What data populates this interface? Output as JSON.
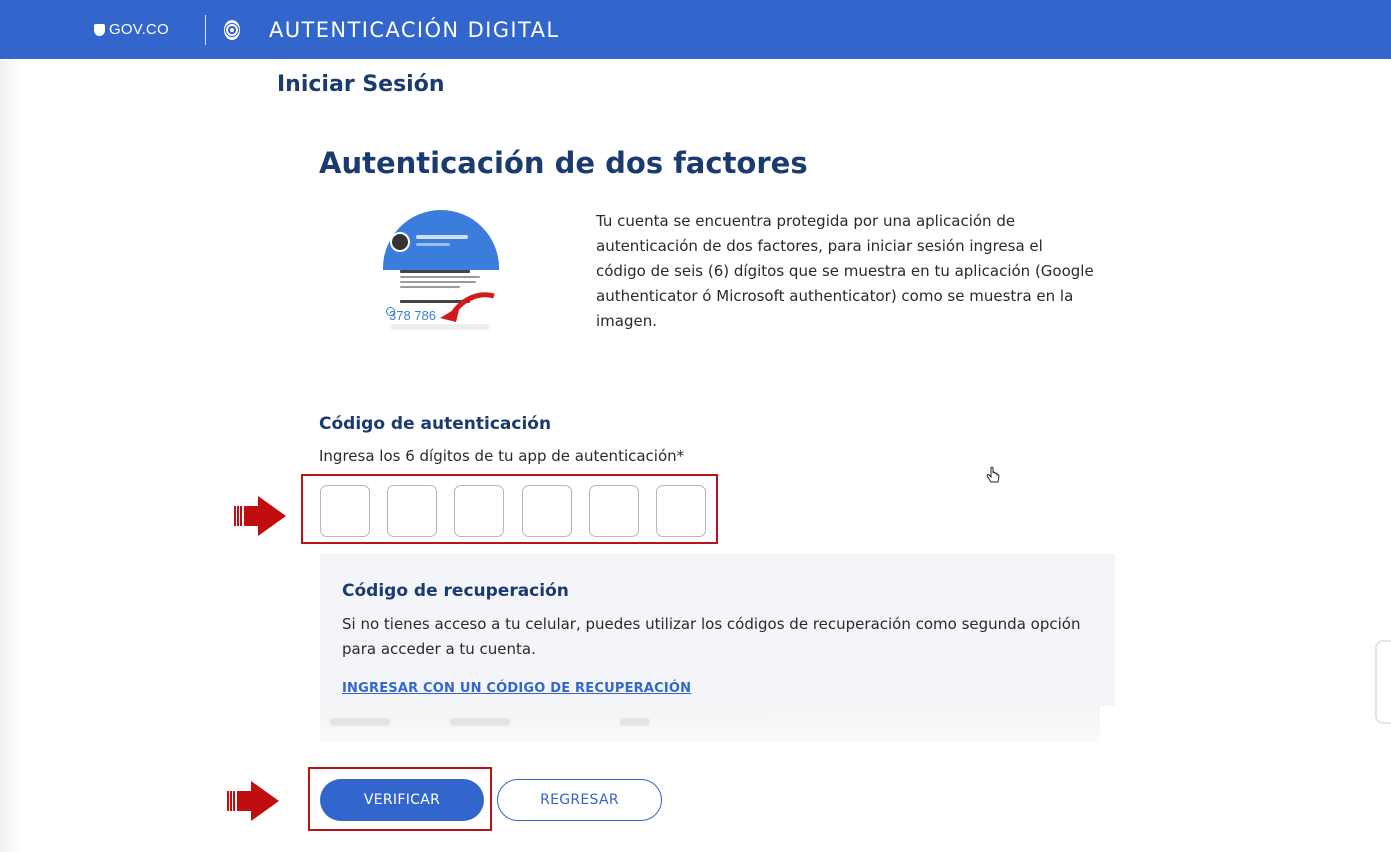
{
  "header": {
    "gov_logo": "GOV.CO",
    "title": "AUTENTICACIÓN DIGITAL"
  },
  "page": {
    "heading": "Iniciar Sesión",
    "title": "Autenticación de dos factores",
    "description": "Tu cuenta se encuentra protegida por una aplicación de autenticación de dos factores, para iniciar sesión ingresa el código de seis (6) dígitos que se muestra en tu aplicación (Google authenticator ó Microsoft authenticator) como se muestra en la imagen."
  },
  "illustration": {
    "code": "378 786"
  },
  "code_form": {
    "label": "Código de autenticación",
    "help": "Ingresa los 6 dígitos de tu app de autenticación*",
    "digits": [
      "",
      "",
      "",
      "",
      "",
      ""
    ]
  },
  "recovery": {
    "title": "Código de recuperación",
    "text": "Si no tienes acceso a tu celular, puedes utilizar los códigos de recuperación como segunda opción para acceder a tu cuenta.",
    "link": "INGRESAR CON UN CÓDIGO DE RECUPERACIÓN"
  },
  "actions": {
    "verify": "VERIFICAR",
    "back": "REGRESAR"
  },
  "colors": {
    "brand": "#3366cc",
    "heading": "#1a3a70",
    "highlight": "#b8121a"
  }
}
